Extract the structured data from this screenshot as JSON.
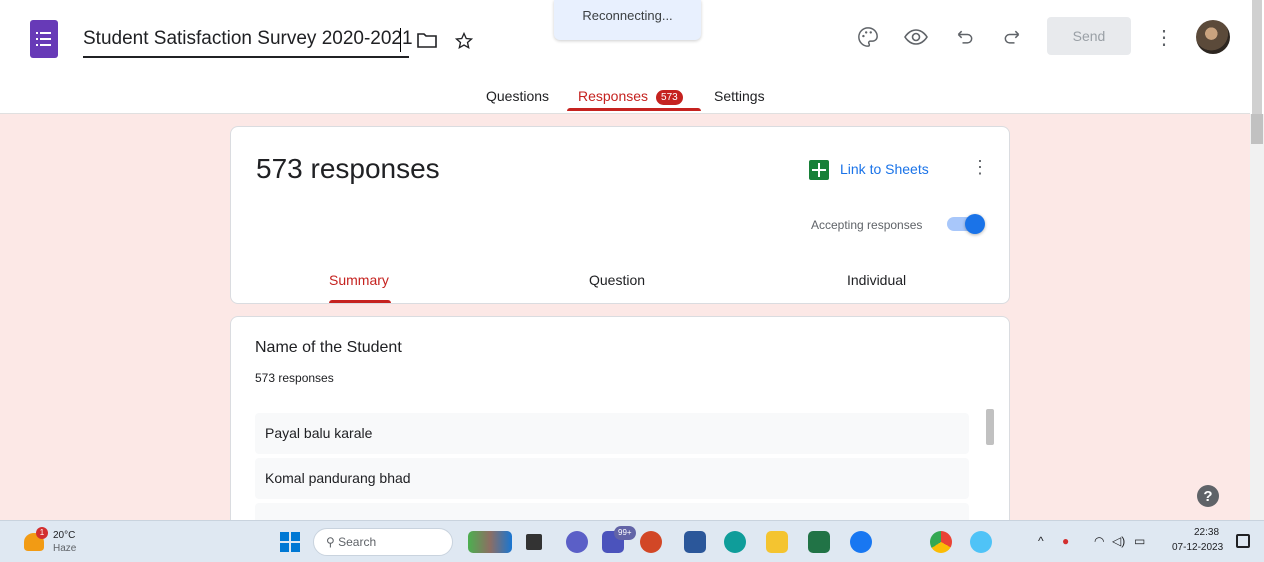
{
  "header": {
    "form_title": "Student Satisfaction Survey 2020-2021",
    "toast": "Reconnecting...",
    "send_label": "Send",
    "icons": [
      "forms-logo-icon",
      "folder-icon",
      "star-icon",
      "palette-icon",
      "eye-icon",
      "undo-icon",
      "redo-icon",
      "more-vert-icon"
    ]
  },
  "tabs": {
    "questions": "Questions",
    "responses": "Responses",
    "responses_count": "573",
    "settings": "Settings"
  },
  "summary_card": {
    "title": "573 responses",
    "link_to_sheets": "Link to Sheets",
    "accepting_label": "Accepting responses",
    "accepting_on": true,
    "subtabs": [
      "Summary",
      "Question",
      "Individual"
    ]
  },
  "question_card": {
    "title": "Name of the Student",
    "count": "573 responses",
    "responses": [
      "Payal balu karale",
      "Komal pandurang bhad"
    ]
  },
  "taskbar": {
    "temp": "20°C",
    "weather": "Haze",
    "weather_badge": "1",
    "search_placeholder": "Search",
    "teams_badge": "99+",
    "time": "22:38",
    "date": "07-12-2023"
  },
  "colors": {
    "accent_red": "#c5221f",
    "forms_purple": "#673ab7",
    "background_pink": "#fce8e6",
    "link_blue": "#1a73e8"
  }
}
